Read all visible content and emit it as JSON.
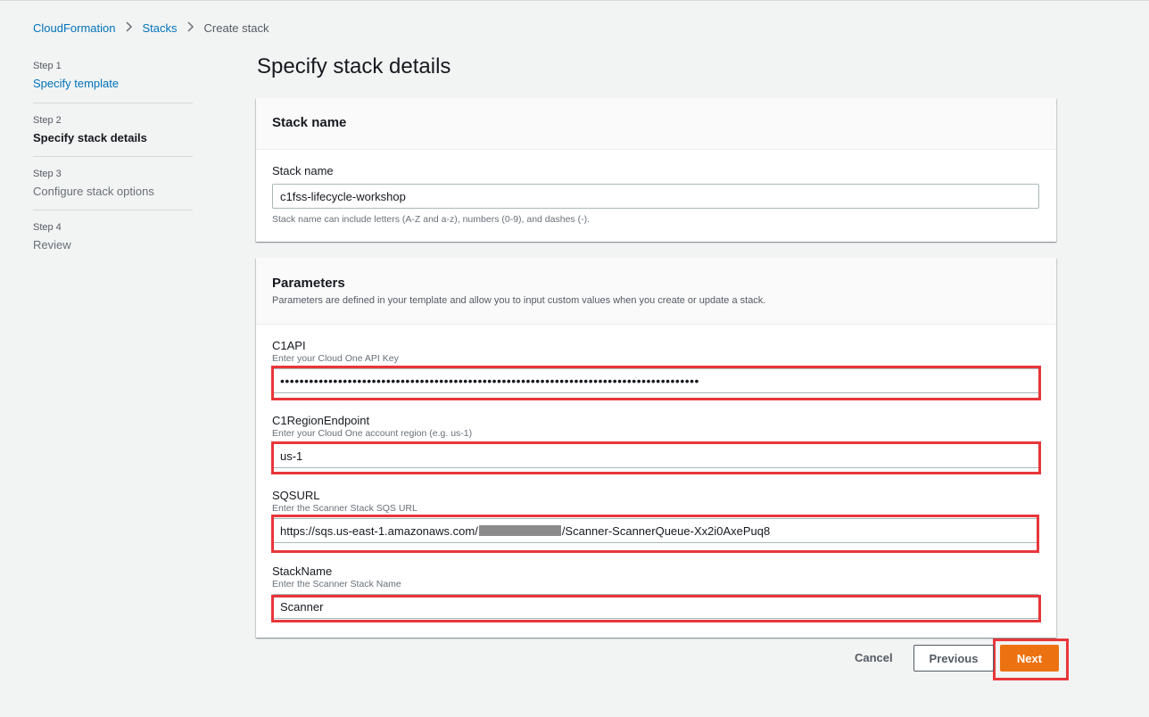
{
  "breadcrumb": {
    "items": [
      "CloudFormation",
      "Stacks"
    ],
    "current": "Create stack"
  },
  "steps": [
    {
      "num": "Step 1",
      "title": "Specify template",
      "state": "link"
    },
    {
      "num": "Step 2",
      "title": "Specify stack details",
      "state": "active"
    },
    {
      "num": "Step 3",
      "title": "Configure stack options",
      "state": "disabled"
    },
    {
      "num": "Step 4",
      "title": "Review",
      "state": "disabled"
    }
  ],
  "page_title": "Specify stack details",
  "stack_name_panel": {
    "heading": "Stack name",
    "label": "Stack name",
    "value": "c1fss-lifecycle-workshop",
    "constraint": "Stack name can include letters (A-Z and a-z), numbers (0-9), and dashes (-)."
  },
  "parameters_panel": {
    "heading": "Parameters",
    "description": "Parameters are defined in your template and allow you to input custom values when you create or update a stack.",
    "params": [
      {
        "label": "C1API",
        "description": "Enter your Cloud One API Key",
        "value": "•••••••••••••••••••••••••••••••••••••••••••••••••••••••••••••••••••••••••••••••••••••••"
      },
      {
        "label": "C1RegionEndpoint",
        "description": "Enter your Cloud One account region (e.g. us-1)",
        "value": "us-1"
      },
      {
        "label": "SQSURL",
        "description": "Enter the Scanner Stack SQS URL",
        "value_prefix": "https://sqs.us-east-1.amazonaws.com/",
        "value_suffix": "/Scanner-ScannerQueue-Xx2i0AxePuq8"
      },
      {
        "label": "StackName",
        "description": "Enter the Scanner Stack Name",
        "value": "Scanner"
      }
    ]
  },
  "footer": {
    "cancel": "Cancel",
    "previous": "Previous",
    "next": "Next"
  },
  "colors": {
    "accent": "#ec7211",
    "link": "#0073bb",
    "highlight": "#e8363a"
  }
}
